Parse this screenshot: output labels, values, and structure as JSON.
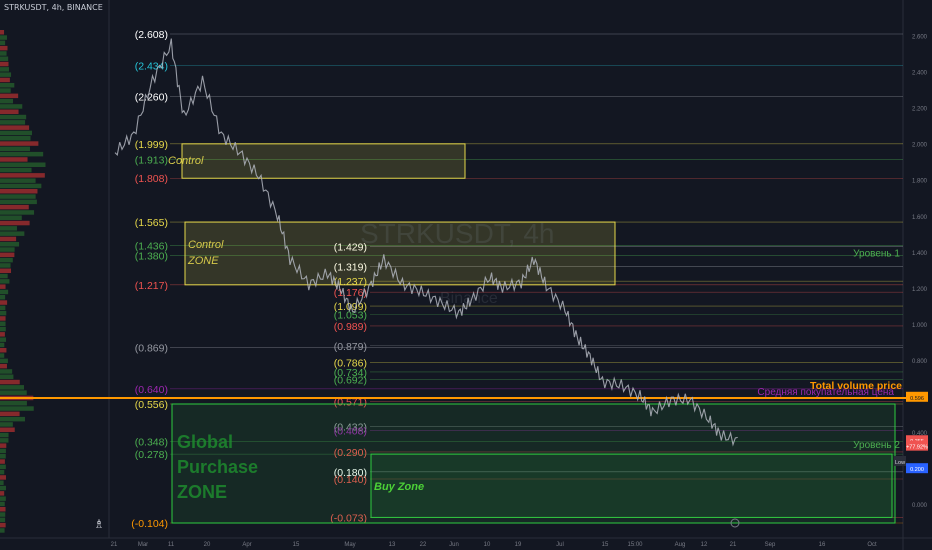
{
  "header": {
    "symbol_line": "STRKUSDT, 4h, BINANCE"
  },
  "watermark": {
    "title": "STRKUSDT, 4h",
    "subtitle": "Binance"
  },
  "colors": {
    "background": "#131722",
    "axis_text": "#787b86",
    "grid": "#2a2e39",
    "candle": "#b2b5be",
    "control_box": "#e6d84a",
    "green_zone": "#2ecc40",
    "orange_line": "#ff9800"
  },
  "chart_data": {
    "type": "line",
    "symbol": "STRKUSDT",
    "interval": "4h",
    "exchange": "BINANCE",
    "ylim": [
      -0.104,
      2.7
    ],
    "y_ticks": [
      "2.600",
      "2.400",
      "2.200",
      "2.000",
      "1.800",
      "1.600",
      "1.400",
      "1.200",
      "1.000",
      "0.800",
      "0.600",
      "0.400",
      "0.200",
      "0.000"
    ],
    "x_ticks": [
      "21",
      "Mar",
      "11",
      "20",
      "Apr",
      "15",
      "May",
      "13",
      "22",
      "Jun",
      "10",
      "19",
      "Jul",
      "15",
      "15:00",
      "Aug",
      "12",
      "21",
      "Sep",
      "16",
      "Oct"
    ],
    "price_labels": [
      {
        "text": "(2.608)",
        "value": 2.608,
        "color": "#ffffff"
      },
      {
        "text": "(2.434)",
        "value": 2.434,
        "color": "#26c6da"
      },
      {
        "text": "(2.260)",
        "value": 2.26,
        "color": "#ffffff"
      },
      {
        "text": "(1.999)",
        "value": 1.999,
        "color": "#e6d84a"
      },
      {
        "text": "(1.913)",
        "value": 1.913,
        "color": "#4caf50"
      },
      {
        "text": "(1.808)",
        "value": 1.808,
        "color": "#ef5350"
      },
      {
        "text": "(1.565)",
        "value": 1.565,
        "color": "#e6d84a"
      },
      {
        "text": "(1.436)",
        "value": 1.436,
        "color": "#4caf50"
      },
      {
        "text": "(1.380)",
        "value": 1.38,
        "color": "#4caf50"
      },
      {
        "text": "(1.217)",
        "value": 1.217,
        "color": "#ef5350"
      },
      {
        "text": "(0.869)",
        "value": 0.869,
        "color": "#9598a1"
      },
      {
        "text": "(0.640)",
        "value": 0.64,
        "color": "#9c27b0"
      },
      {
        "text": "(0.556)",
        "value": 0.556,
        "color": "#e6d84a"
      },
      {
        "text": "(0.348)",
        "value": 0.348,
        "color": "#4caf50"
      },
      {
        "text": "(0.278)",
        "value": 0.278,
        "color": "#4caf50"
      },
      {
        "text": "(-0.104)",
        "value": -0.104,
        "color": "#ff9800"
      }
    ],
    "inner_labels": [
      {
        "text": "(1.429)",
        "value": 1.429,
        "color": "#ffffff"
      },
      {
        "text": "(1.319)",
        "value": 1.319,
        "color": "#ffffff"
      },
      {
        "text": "(1.237)",
        "value": 1.237,
        "color": "#e6d84a"
      },
      {
        "text": "(1.176)",
        "value": 1.176,
        "color": "#ef5350"
      },
      {
        "text": "(1.099)",
        "value": 1.099,
        "color": "#e6d84a"
      },
      {
        "text": "(1.053)",
        "value": 1.053,
        "color": "#4caf50"
      },
      {
        "text": "(0.989)",
        "value": 0.989,
        "color": "#ef5350"
      },
      {
        "text": "(0.879)",
        "value": 0.879,
        "color": "#9598a1"
      },
      {
        "text": "(0.786)",
        "value": 0.786,
        "color": "#e6d84a"
      },
      {
        "text": "(0.734)",
        "value": 0.734,
        "color": "#4caf50"
      },
      {
        "text": "(0.692)",
        "value": 0.692,
        "color": "#4caf50"
      },
      {
        "text": "(0.571)",
        "value": 0.571,
        "color": "#ef5350"
      },
      {
        "text": "(0.432)",
        "value": 0.432,
        "color": "#9598a1"
      },
      {
        "text": "(0.408)",
        "value": 0.408,
        "color": "#9c27b0"
      },
      {
        "text": "(0.290)",
        "value": 0.29,
        "color": "#ef5350"
      },
      {
        "text": "(0.180)",
        "value": 0.18,
        "color": "#ffffff"
      },
      {
        "text": "(0.140)",
        "value": 0.14,
        "color": "#ef5350"
      },
      {
        "text": "(-0.073)",
        "value": -0.073,
        "color": "#ef5350"
      }
    ],
    "zones": [
      {
        "name": "Control",
        "top": 1.999,
        "bottom": 1.808,
        "color": "#e6d84a"
      },
      {
        "name": "Control ZONE",
        "top": 1.565,
        "bottom": 1.217,
        "color": "#e6d84a"
      },
      {
        "name": "Global Purchase ZONE",
        "top": 0.556,
        "bottom": -0.104,
        "color": "#2ecc40"
      },
      {
        "name": "Buy Zone",
        "top": 0.278,
        "bottom": -0.073,
        "color": "#2ecc40"
      }
    ],
    "zone_text": {
      "control": "Control",
      "control_zone_1": "Control",
      "control_zone_2": "ZONE",
      "global_1": "Global",
      "global_2": "Purchase",
      "global_3": "ZONE",
      "buy": "Buy Zone"
    },
    "right_annotations": {
      "level1": "Уровень 1",
      "level2": "Уровень 2",
      "total_volume": "Total volume price",
      "avg_buy": "Средняя покупательная цена"
    },
    "axis_badges": [
      {
        "text": "0.596",
        "value": 0.596,
        "bg": "#ff9800",
        "fg": "#131722"
      },
      {
        "text": "0.355",
        "value": 0.355,
        "bg": "#ef5350",
        "fg": "#ffffff"
      },
      {
        "text": "+77.92%",
        "value": 0.325,
        "bg": "#ef5350",
        "fg": "#ffffff"
      },
      {
        "text": "0.200",
        "value": 0.2,
        "bg": "#2962ff",
        "fg": "#ffffff"
      }
    ],
    "low_label": "Low",
    "price_path": [
      [
        0.0,
        1.95
      ],
      [
        0.03,
        2.05
      ],
      [
        0.06,
        2.35
      ],
      [
        0.09,
        2.55
      ],
      [
        0.11,
        2.15
      ],
      [
        0.14,
        2.35
      ],
      [
        0.17,
        2.05
      ],
      [
        0.2,
        1.95
      ],
      [
        0.23,
        1.82
      ],
      [
        0.26,
        1.6
      ],
      [
        0.28,
        1.36
      ],
      [
        0.31,
        1.22
      ],
      [
        0.34,
        1.28
      ],
      [
        0.36,
        1.2
      ],
      [
        0.38,
        1.07
      ],
      [
        0.41,
        1.22
      ],
      [
        0.43,
        1.36
      ],
      [
        0.46,
        1.22
      ],
      [
        0.49,
        1.18
      ],
      [
        0.52,
        1.12
      ],
      [
        0.55,
        1.06
      ],
      [
        0.57,
        1.13
      ],
      [
        0.6,
        1.26
      ],
      [
        0.62,
        1.2
      ],
      [
        0.65,
        1.23
      ],
      [
        0.67,
        1.36
      ],
      [
        0.69,
        1.21
      ],
      [
        0.72,
        1.08
      ],
      [
        0.74,
        0.92
      ],
      [
        0.76,
        0.82
      ],
      [
        0.78,
        0.68
      ],
      [
        0.81,
        0.66
      ],
      [
        0.84,
        0.6
      ],
      [
        0.86,
        0.51
      ],
      [
        0.89,
        0.58
      ],
      [
        0.92,
        0.58
      ],
      [
        0.95,
        0.47
      ],
      [
        0.97,
        0.38
      ],
      [
        1.0,
        0.35
      ]
    ]
  }
}
